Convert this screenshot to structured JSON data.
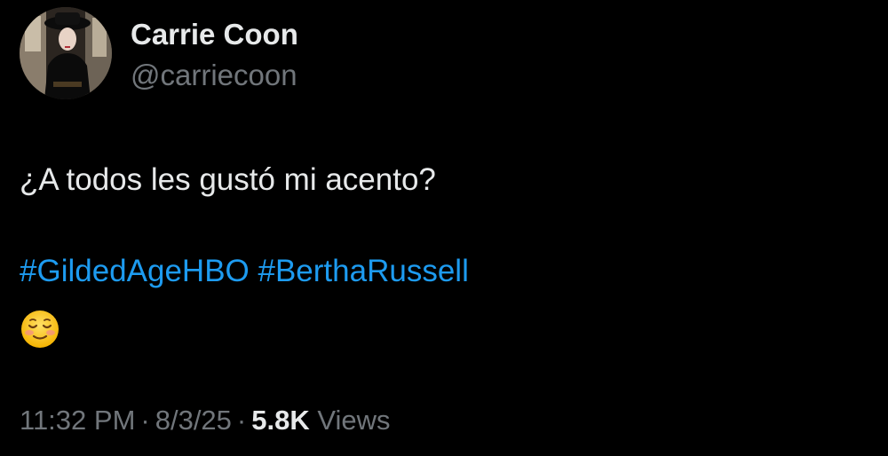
{
  "author": {
    "name": "Carrie Coon",
    "handle": "@carriecoon"
  },
  "tweet": {
    "text": "¿A todos les gustó mi acento?",
    "hashtags": [
      "#GildedAgeHBO",
      "#BerthaRussell"
    ],
    "emoji_icon": "smiling-face-icon"
  },
  "meta": {
    "time": "11:32 PM",
    "date": "8/3/25",
    "separator": "·",
    "views_count": "5.8K",
    "views_label": "Views"
  },
  "colors": {
    "background": "#000000",
    "primary_text": "#e7e9ea",
    "secondary_text": "#71767b",
    "link": "#1d9bf0"
  }
}
